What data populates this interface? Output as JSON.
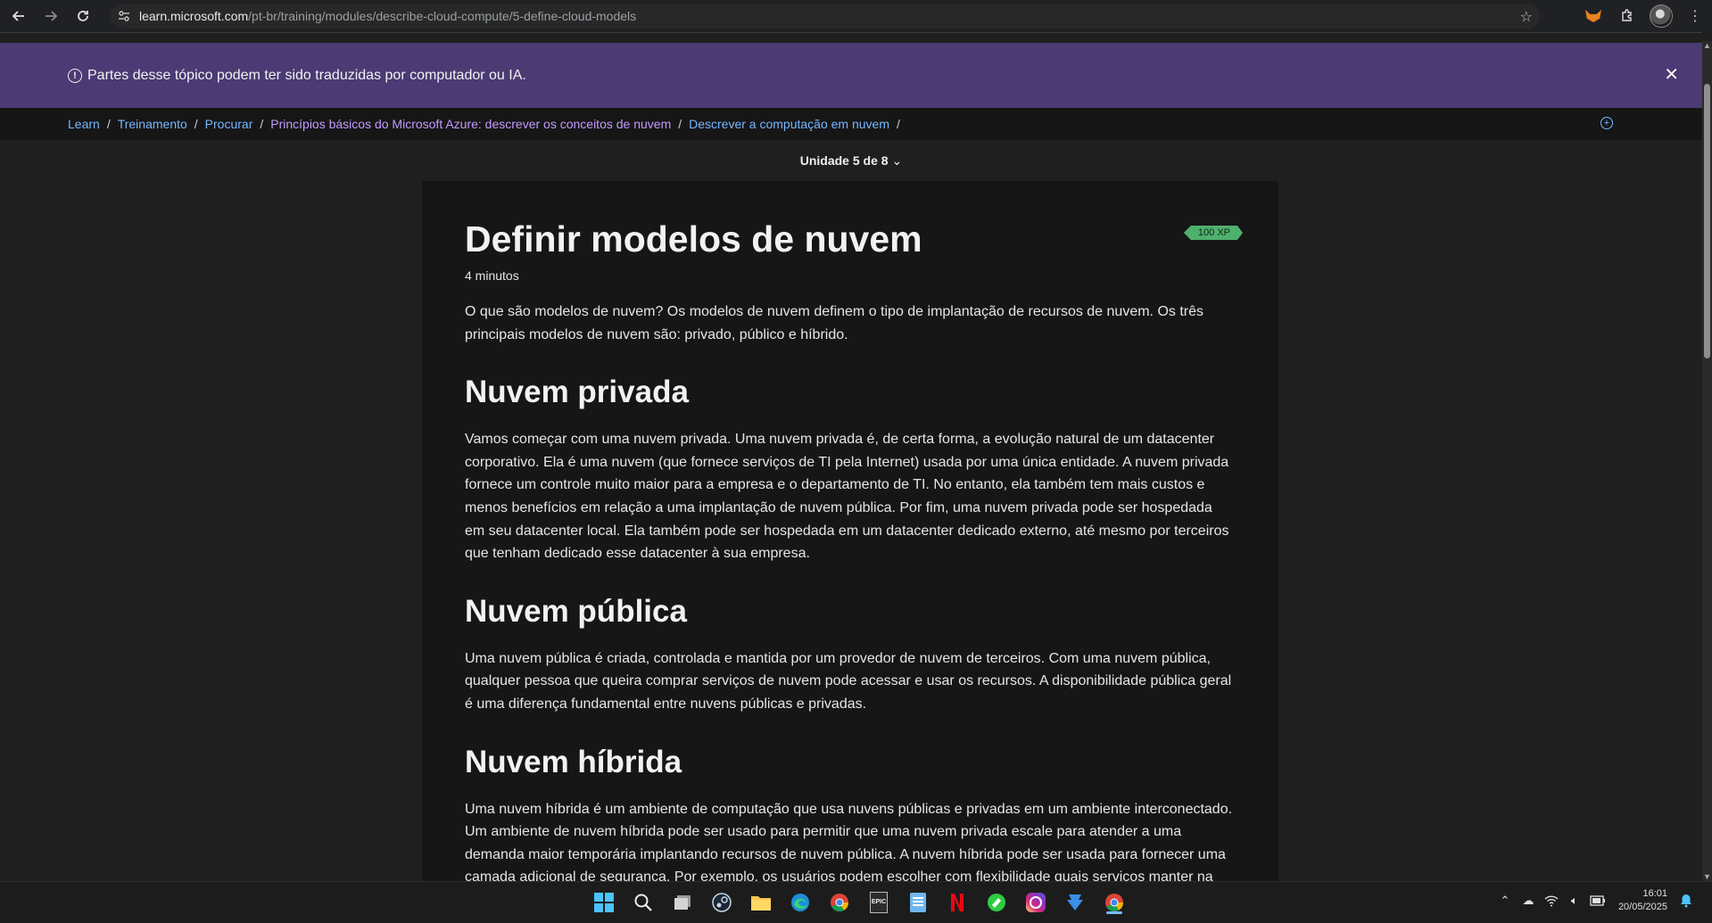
{
  "browser": {
    "url_host": "learn.microsoft.com",
    "url_path": "/pt-br/training/modules/describe-cloud-compute/5-define-cloud-models"
  },
  "banner": {
    "text": "Partes desse tópico podem ter sido traduzidas por computador ou IA.",
    "close_icon": "close-icon"
  },
  "breadcrumbs": [
    {
      "label": "Learn"
    },
    {
      "label": "Treinamento"
    },
    {
      "label": "Procurar"
    },
    {
      "label": "Princípios básicos do Microsoft Azure: descrever os conceitos de nuvem"
    },
    {
      "label": "Descrever a computação em nuvem"
    }
  ],
  "unit_selector": "Unidade 5 de 8",
  "article": {
    "title": "Definir modelos de nuvem",
    "xp": "100 XP",
    "duration": "4 minutos",
    "intro": "O que são modelos de nuvem? Os modelos de nuvem definem o tipo de implantação de recursos de nuvem. Os três principais modelos de nuvem são: privado, público e híbrido.",
    "sections": [
      {
        "heading": "Nuvem privada",
        "body": "Vamos começar com uma nuvem privada. Uma nuvem privada é, de certa forma, a evolução natural de um datacenter corporativo. Ela é uma nuvem (que fornece serviços de TI pela Internet) usada por uma única entidade. A nuvem privada fornece um controle muito maior para a empresa e o departamento de TI. No entanto, ela também tem mais custos e menos benefícios em relação a uma implantação de nuvem pública. Por fim, uma nuvem privada pode ser hospedada em seu datacenter local. Ela também pode ser hospedada em um datacenter dedicado externo, até mesmo por terceiros que tenham dedicado esse datacenter à sua empresa."
      },
      {
        "heading": "Nuvem pública",
        "body": "Uma nuvem pública é criada, controlada e mantida por um provedor de nuvem de terceiros. Com uma nuvem pública, qualquer pessoa que queira comprar serviços de nuvem pode acessar e usar os recursos. A disponibilidade pública geral é uma diferença fundamental entre nuvens públicas e privadas."
      },
      {
        "heading": "Nuvem híbrida",
        "body": "Uma nuvem híbrida é um ambiente de computação que usa nuvens públicas e privadas em um ambiente interconectado. Um ambiente de nuvem híbrida pode ser usado para permitir que uma nuvem privada escale para atender a uma demanda maior temporária implantando recursos de nuvem pública. A nuvem híbrida pode ser usada para fornecer uma camada adicional de segurança. Por exemplo, os usuários podem escolher com flexibilidade quais serviços manter na"
      }
    ]
  },
  "taskbar": {
    "apps": [
      "windows-start",
      "search",
      "task-view",
      "steam",
      "file-explorer",
      "edge",
      "chrome",
      "epic-games",
      "notepad",
      "netflix",
      "stremio",
      "instagram",
      "download-manager",
      "chrome-active"
    ],
    "epic_label": "EPIC",
    "time": "16:01",
    "date": "20/05/2025"
  },
  "colors": {
    "banner_bg": "#4b3a73",
    "link": "#75b6ff",
    "link_visited": "#c39bff",
    "xp_badge": "#4fb06e"
  }
}
